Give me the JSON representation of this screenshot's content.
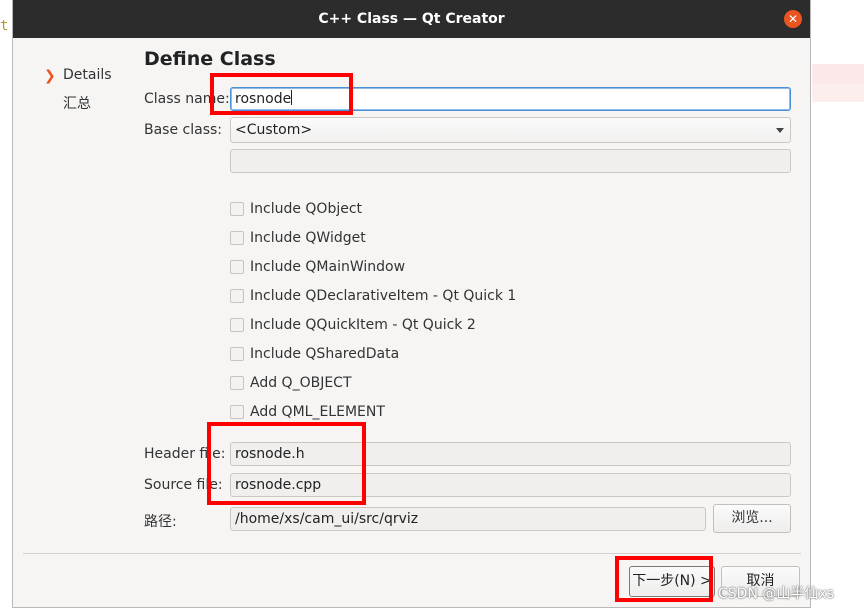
{
  "background": {
    "glyph": "t"
  },
  "window": {
    "title": "C++ Class — Qt Creator",
    "close_icon": "close-icon"
  },
  "nav": {
    "items": [
      {
        "label": "Details",
        "active": true
      },
      {
        "label": "汇总",
        "active": false
      }
    ]
  },
  "page": {
    "title": "Define Class"
  },
  "form": {
    "class_name_label": "Class name:",
    "class_name_value": "rosnode",
    "base_class_label": "Base class:",
    "base_class_value": "<Custom>",
    "custom_base_value": "",
    "checkboxes": [
      {
        "label": "Include QObject",
        "checked": false
      },
      {
        "label": "Include QWidget",
        "checked": false
      },
      {
        "label": "Include QMainWindow",
        "checked": false
      },
      {
        "label": "Include QDeclarativeItem - Qt Quick 1",
        "checked": false
      },
      {
        "label": "Include QQuickItem - Qt Quick 2",
        "checked": false
      },
      {
        "label": "Include QSharedData",
        "checked": false
      },
      {
        "label": "Add Q_OBJECT",
        "checked": false
      },
      {
        "label": "Add QML_ELEMENT",
        "checked": false
      }
    ],
    "header_file_label": "Header file:",
    "header_file_value": "rosnode.h",
    "source_file_label": "Source file:",
    "source_file_value": "rosnode.cpp",
    "path_label": "路径:",
    "path_value": "/home/xs/cam_ui/src/qrviz",
    "browse_label": "浏览..."
  },
  "buttons": {
    "next_label": "下一步(N) >",
    "cancel_label": "取消"
  },
  "watermark": "CSDN @山半仙xs",
  "colors": {
    "accent": "#e95420",
    "highlight_box": "#ff0000",
    "titlebar": "#2c2c2c"
  }
}
